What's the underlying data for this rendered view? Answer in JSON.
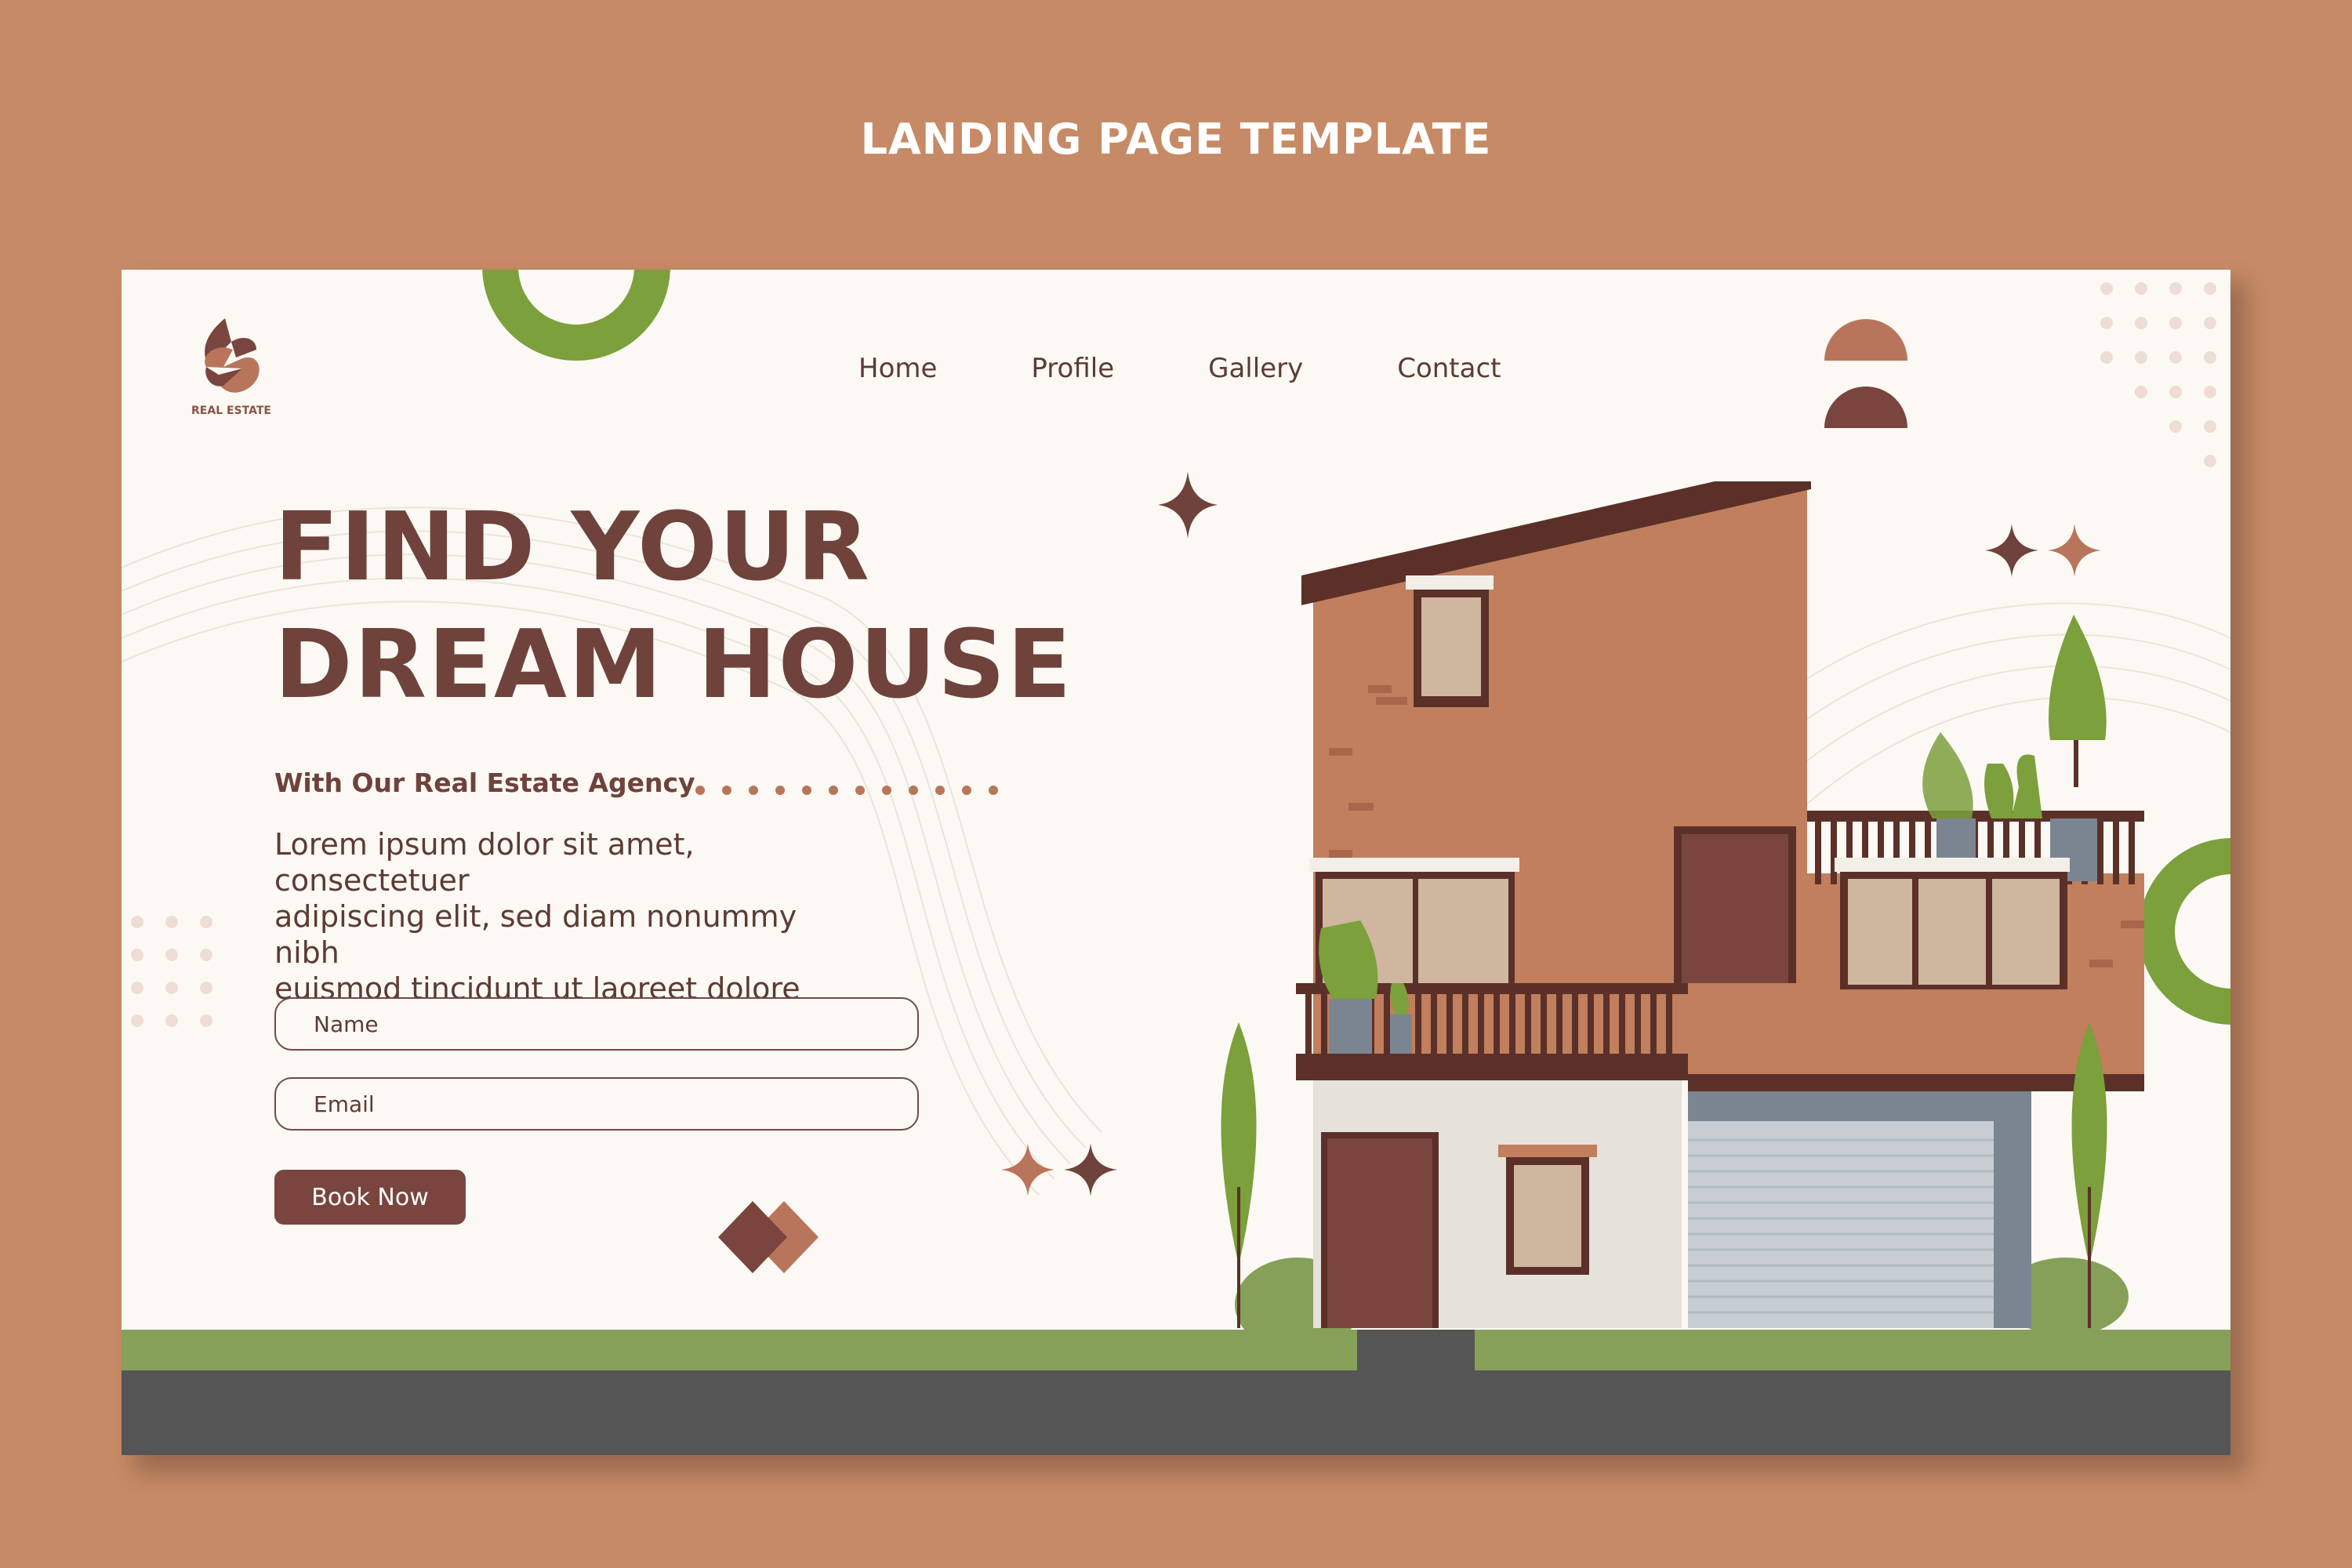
{
  "banner": {
    "title": "LANDING PAGE TEMPLATE"
  },
  "brand": {
    "logo_text": "REAL ESTATE"
  },
  "nav": {
    "items": [
      "Home",
      "Profile",
      "Gallery",
      "Contact"
    ]
  },
  "hero": {
    "headline_line1": "FIND YOUR",
    "headline_line2": "DREAM HOUSE",
    "subtitle": "With Our Real Estate Agency",
    "body_line1": "Lorem ipsum dolor sit amet, consectetuer",
    "body_line2": "adipiscing elit, sed diam nonummy nibh",
    "body_line3": "euismod tincidunt ut laoreet dolore magna"
  },
  "form": {
    "name_placeholder": "Name",
    "email_placeholder": "Email",
    "submit_label": "Book Now"
  },
  "colors": {
    "background": "#c78a66",
    "page": "#fcf9f4",
    "primary_brown": "#6f423b",
    "green_accent": "#7ba03c",
    "grass": "#86a05a",
    "road": "#555555"
  }
}
